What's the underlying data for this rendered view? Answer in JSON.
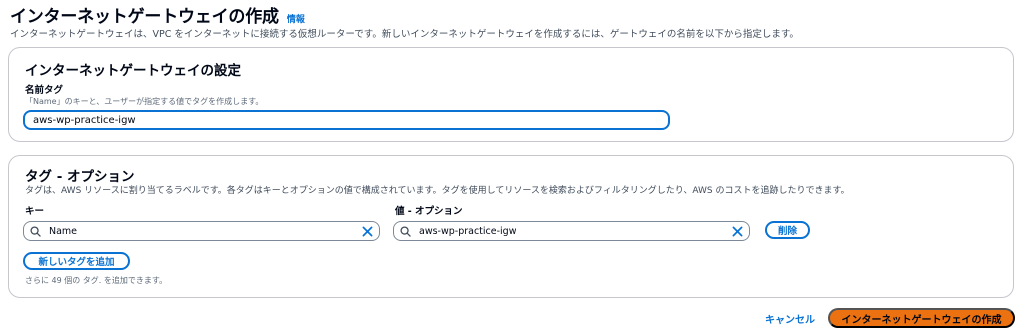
{
  "header": {
    "title": "インターネットゲートウェイの作成",
    "info_label": "情報",
    "description": "インターネットゲートウェイは、VPC をインターネットに接続する仮想ルーターです。新しいインターネットゲートウェイを作成するには、ゲートウェイの名前を以下から指定します。"
  },
  "settings": {
    "title": "インターネットゲートウェイの設定",
    "name_tag_label": "名前タグ",
    "name_tag_hint": "「Name」のキーと、ユーザーが指定する値でタグを作成します。",
    "name_tag_value": "aws-wp-practice-igw"
  },
  "tags": {
    "title": "タグ - オプション",
    "description": "タグは、AWS リソースに割り当てるラベルです。各タグはキーとオプションの値で構成されています。タグを使用してリソースを検索およびフィルタリングしたり、AWS のコストを追跡したりできます。",
    "key_label": "キー",
    "value_label": "値 - オプション",
    "rows": [
      {
        "key": "Name",
        "value": "aws-wp-practice-igw",
        "remove_label": "削除"
      }
    ],
    "add_label": "新しいタグを追加",
    "limit_text": "さらに 49 個の タグ. を追加できます。"
  },
  "footer": {
    "cancel_label": "キャンセル",
    "submit_label": "インターネットゲートウェイの作成"
  },
  "colors": {
    "primary": "#ec7211",
    "link": "#0972d3",
    "border": "#c6c6cd"
  }
}
